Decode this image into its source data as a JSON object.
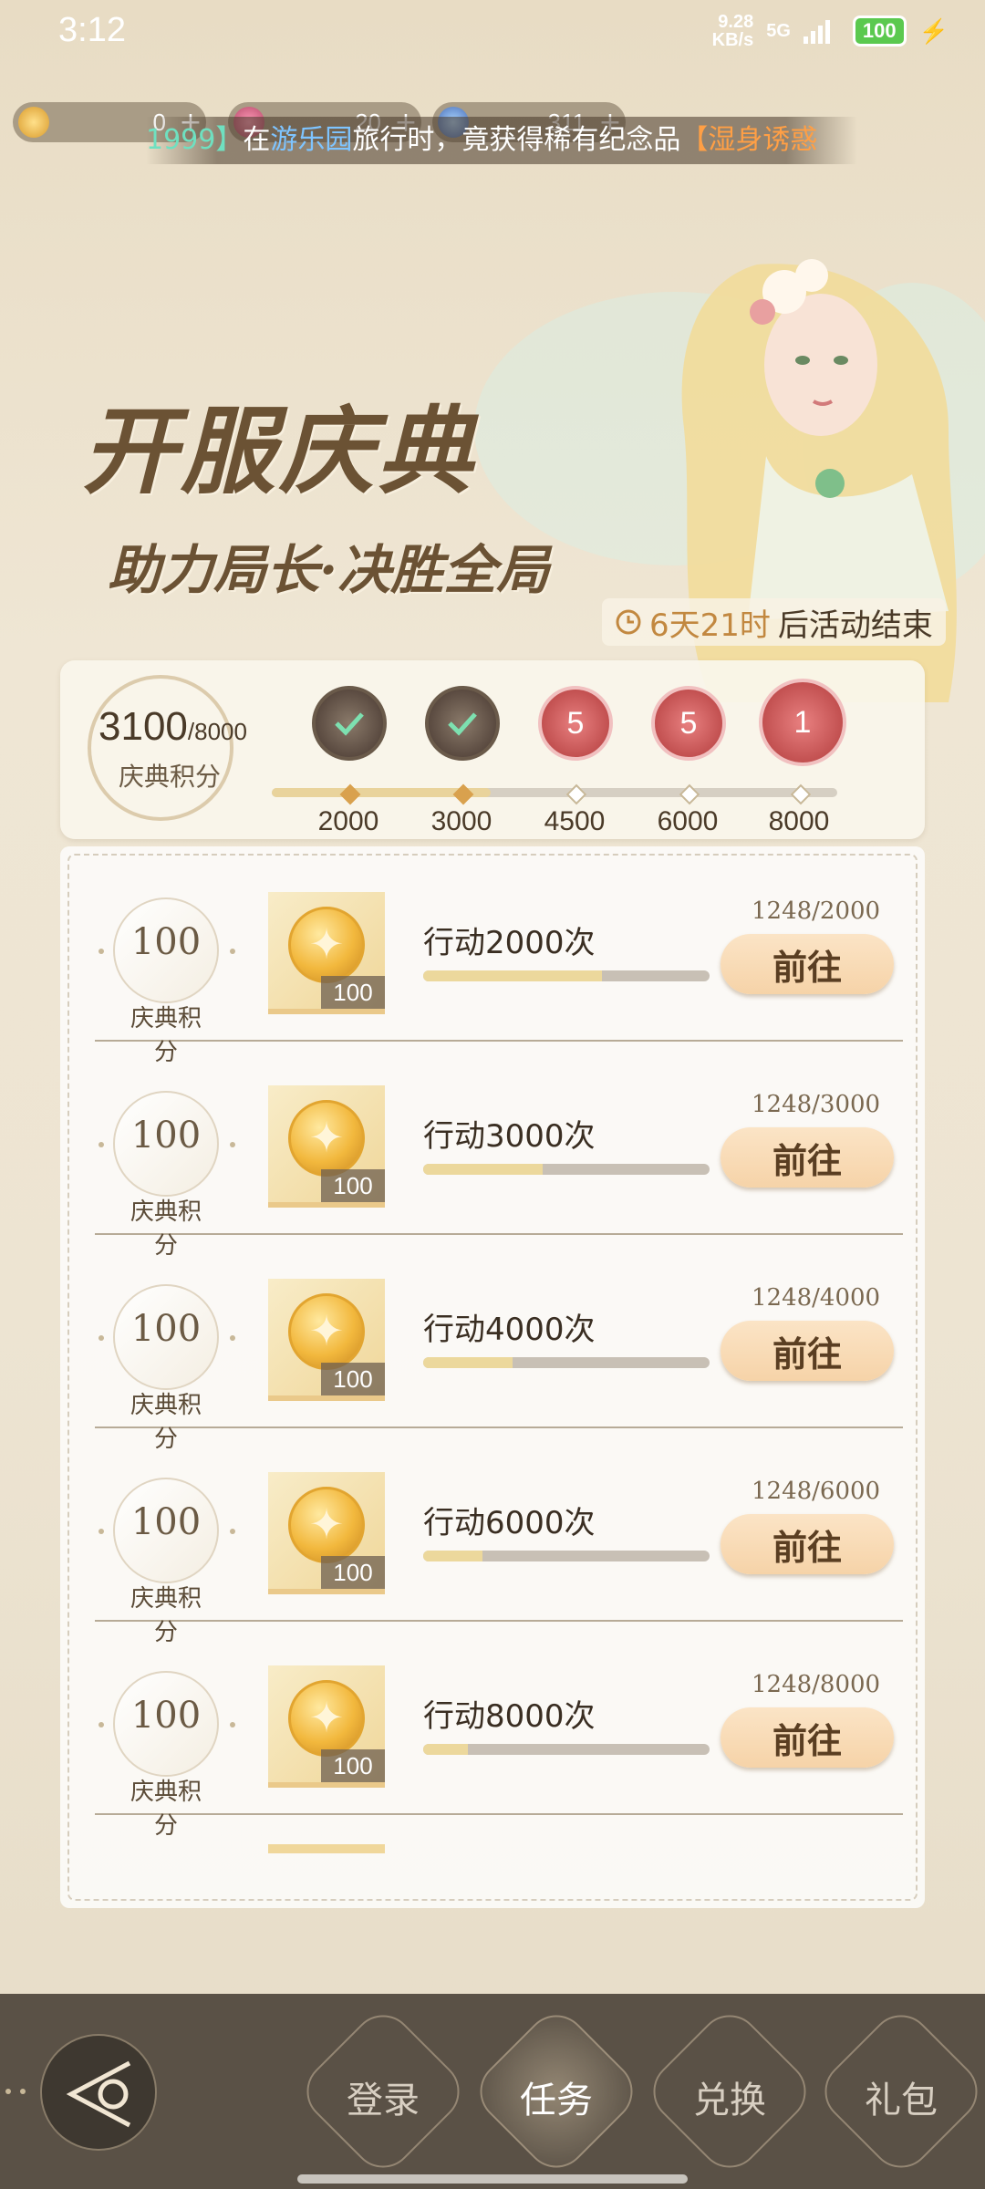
{
  "status_bar": {
    "time": "3:12",
    "speed_value": "9.28",
    "speed_unit": "KB/s",
    "network": "5G",
    "battery": "100"
  },
  "currencies": [
    {
      "icon": "gold-coin-icon",
      "value": "0",
      "plus": "+"
    },
    {
      "icon": "pink-gem-icon",
      "value": "20",
      "plus": "+"
    },
    {
      "icon": "blue-crystal-icon",
      "value": "311",
      "plus": "+"
    }
  ],
  "marquee": {
    "part1": "1999】",
    "part2": "在",
    "part3": "游乐园",
    "part4": "旅行时，竟获得稀有纪念品",
    "part5": "【湿身诱惑"
  },
  "banner": {
    "title": "开服庆典",
    "subtitle": "助力局长·决胜全局",
    "timer_highlight": "6天21时",
    "timer_rest": "后活动结束"
  },
  "score": {
    "value": "3100",
    "max": "/8000",
    "label": "庆典积分",
    "progress_fraction": 0.3875
  },
  "milestones": [
    {
      "threshold": "2000",
      "status": "claimed",
      "badge": ""
    },
    {
      "threshold": "3000",
      "status": "claimed",
      "badge": ""
    },
    {
      "threshold": "4500",
      "status": "locked",
      "badge": "5"
    },
    {
      "threshold": "6000",
      "status": "locked",
      "badge": "5"
    },
    {
      "threshold": "8000",
      "status": "locked",
      "badge": "1"
    }
  ],
  "tasks": [
    {
      "points": "100",
      "points_label": "庆典积分",
      "reward_qty": "100",
      "title": "行动2000次",
      "progress": "1248/2000",
      "ratio": 0.624,
      "button": "前往"
    },
    {
      "points": "100",
      "points_label": "庆典积分",
      "reward_qty": "100",
      "title": "行动3000次",
      "progress": "1248/3000",
      "ratio": 0.416,
      "button": "前往"
    },
    {
      "points": "100",
      "points_label": "庆典积分",
      "reward_qty": "100",
      "title": "行动4000次",
      "progress": "1248/4000",
      "ratio": 0.312,
      "button": "前往"
    },
    {
      "points": "100",
      "points_label": "庆典积分",
      "reward_qty": "100",
      "title": "行动6000次",
      "progress": "1248/6000",
      "ratio": 0.208,
      "button": "前往"
    },
    {
      "points": "100",
      "points_label": "庆典积分",
      "reward_qty": "100",
      "title": "行动8000次",
      "progress": "1248/8000",
      "ratio": 0.156,
      "button": "前往"
    }
  ],
  "bottom_nav": {
    "items": [
      {
        "label": "登录",
        "active": false
      },
      {
        "label": "任务",
        "active": true
      },
      {
        "label": "兑换",
        "active": false
      },
      {
        "label": "礼包",
        "active": false
      }
    ]
  }
}
